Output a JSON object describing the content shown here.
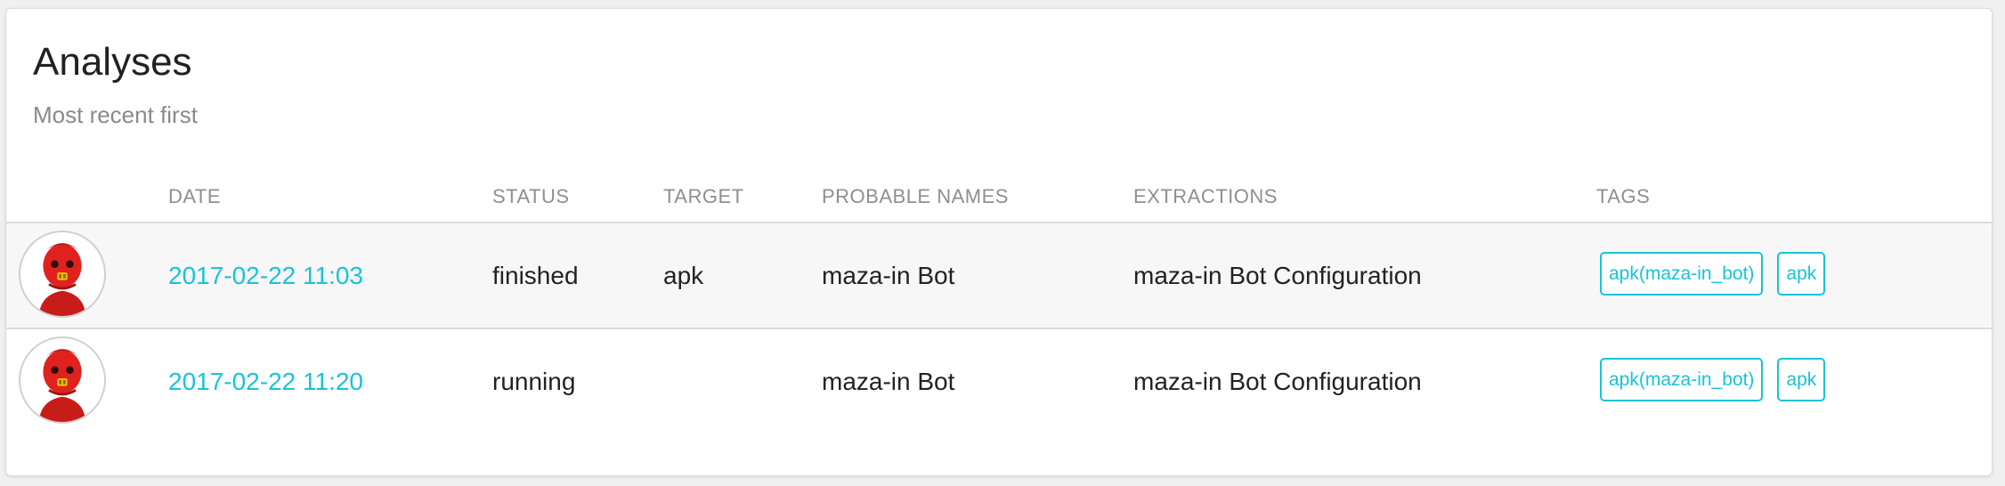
{
  "header": {
    "title": "Analyses",
    "subtitle": "Most recent first"
  },
  "table": {
    "columns": [
      "DATE",
      "STATUS",
      "TARGET",
      "PROBABLE NAMES",
      "EXTRACTIONS",
      "TAGS"
    ],
    "rows": [
      {
        "avatar_icon": "red-robot-icon",
        "date": "2017-02-22 11:03",
        "status": "finished",
        "target": "apk",
        "probable_names": "maza-in Bot",
        "extractions": "maza-in Bot Configuration",
        "tags": [
          "apk(maza-in_bot)",
          "apk"
        ]
      },
      {
        "avatar_icon": "red-robot-icon",
        "date": "2017-02-22 11:20",
        "status": "running",
        "target": "",
        "probable_names": "maza-in Bot",
        "extractions": "maza-in Bot Configuration",
        "tags": [
          "apk(maza-in_bot)",
          "apk"
        ]
      }
    ]
  },
  "colors": {
    "accent": "#19c3d8",
    "text": "#222222",
    "muted": "#8a8a8a",
    "row_alt": "#f7f7f7",
    "robot_red": "#e0221f"
  }
}
